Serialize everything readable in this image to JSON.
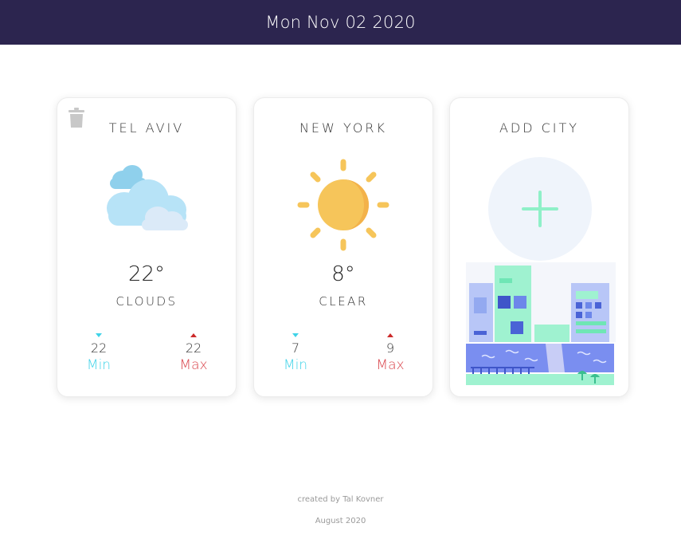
{
  "header": {
    "date": "Mon Nov 02 2020"
  },
  "cards": [
    {
      "city": "TEL AVIV",
      "icon": "clouds-icon",
      "temp": "22°",
      "description": "CLOUDS",
      "min": {
        "value": "22",
        "label": "Min"
      },
      "max": {
        "value": "22",
        "label": "Max"
      },
      "deletable": true
    },
    {
      "city": "NEW YORK",
      "icon": "sun-icon",
      "temp": "8°",
      "description": "CLEAR",
      "min": {
        "value": "7",
        "label": "Min"
      },
      "max": {
        "value": "9",
        "label": "Max"
      }
    }
  ],
  "add_card": {
    "title": "ADD CITY",
    "icon": "plus-icon"
  },
  "footer": {
    "credit": "created by Tal Kovner",
    "date": "August 2020"
  },
  "colors": {
    "header_bg": "#2c254f",
    "min": "#3fd3e8",
    "max": "#d9434a",
    "accent_green": "#8ff0c8"
  }
}
